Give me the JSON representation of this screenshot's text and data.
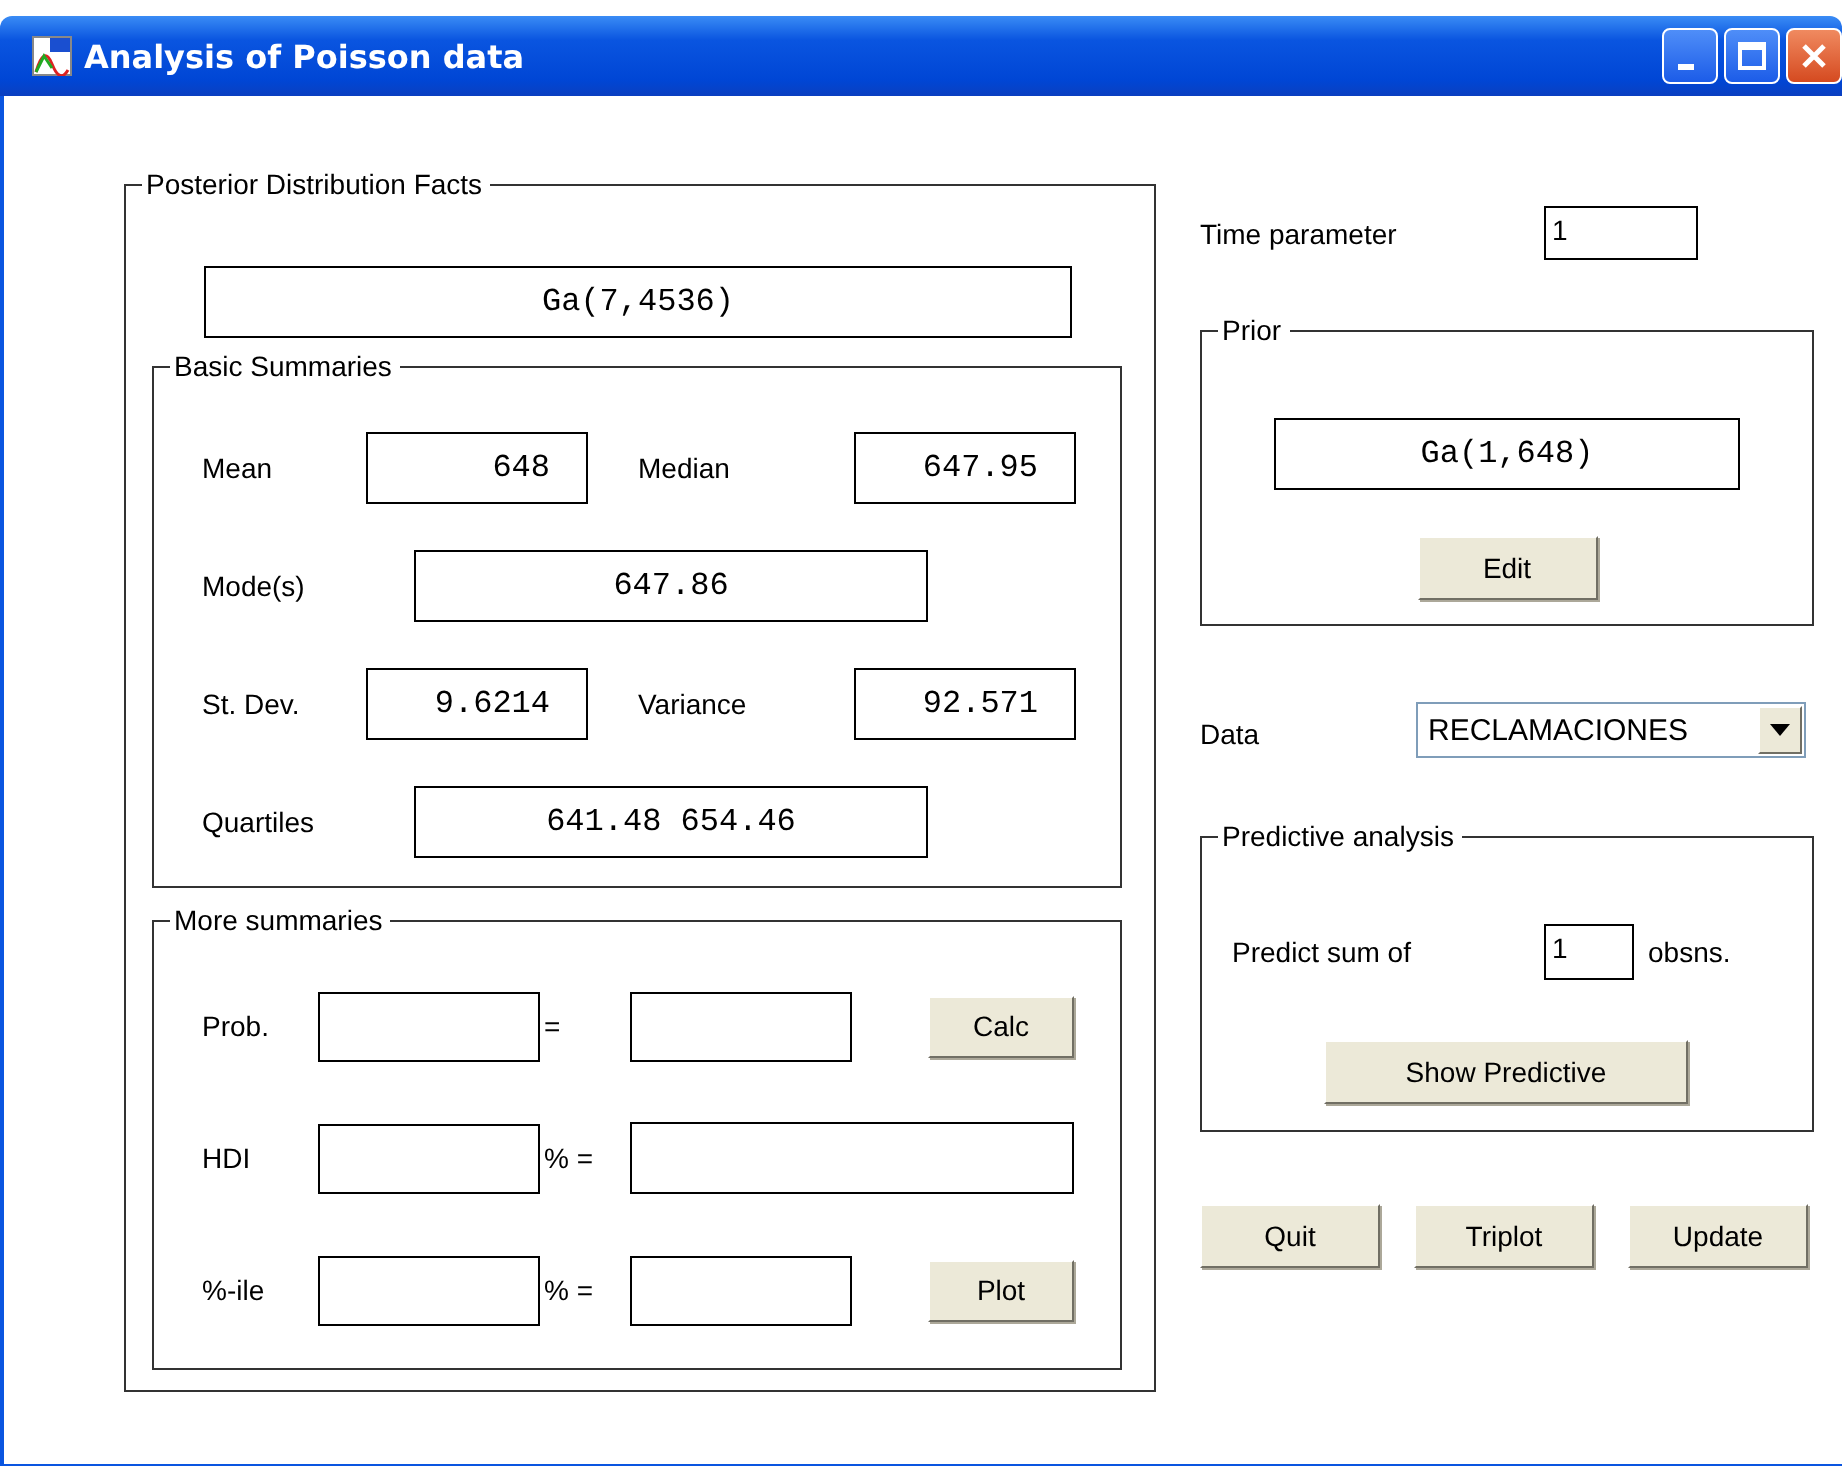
{
  "window": {
    "title": "Analysis of Poisson data"
  },
  "posterior": {
    "title": "Posterior Distribution Facts",
    "distribution": "Ga(7,4536)",
    "basic": {
      "title": "Basic Summaries",
      "rows": [
        [
          {
            "label": "Mean",
            "value": "648"
          },
          {
            "label": "Median",
            "value": "647.95"
          }
        ],
        [
          {
            "label": "Mode(s)",
            "value": "647.86"
          }
        ],
        [
          {
            "label": "St. Dev.",
            "value": "9.6214"
          },
          {
            "label": "Variance",
            "value": "92.571"
          }
        ],
        [
          {
            "label": "Quartiles",
            "value": "641.48 654.46"
          }
        ]
      ]
    },
    "more": {
      "title": "More summaries",
      "rows": [
        {
          "label": "Prob.",
          "separator": "=",
          "button": "Calc"
        },
        {
          "label": "HDI",
          "separator": "% ="
        },
        {
          "label": "%-ile",
          "separator": "% =",
          "button": "Plot"
        }
      ]
    }
  },
  "time_parameter": {
    "label": "Time parameter",
    "value": "1"
  },
  "prior": {
    "title": "Prior",
    "distribution": "Ga(1,648)",
    "button": "Edit"
  },
  "data": {
    "label": "Data",
    "value": "RECLAMACIONES"
  },
  "predictive": {
    "title": "Predictive analysis",
    "label": "Predict sum of",
    "value": "1",
    "unit": "obsns.",
    "button": "Show Predictive"
  },
  "buttons": [
    "Quit",
    "Triplot",
    "Update"
  ]
}
